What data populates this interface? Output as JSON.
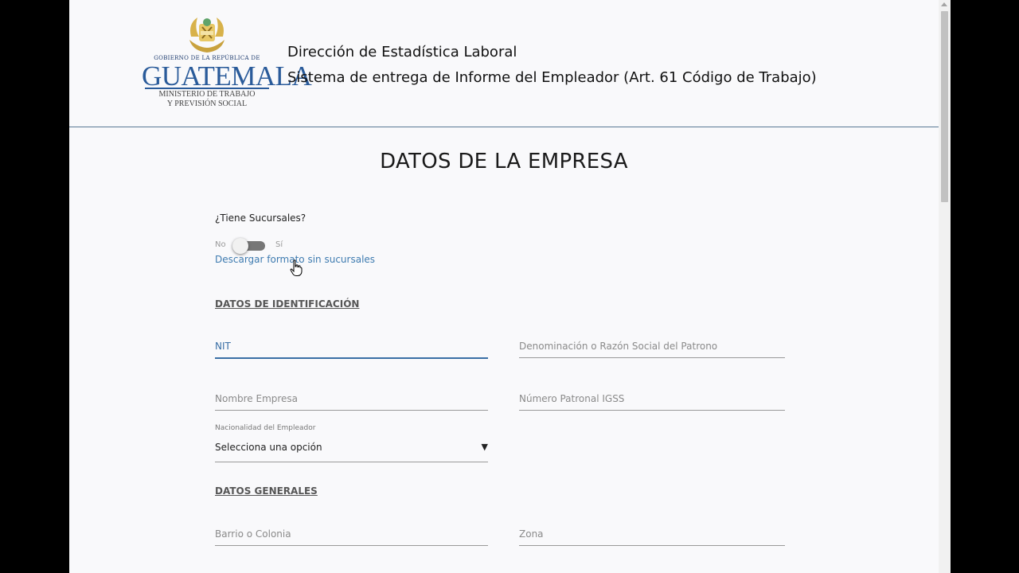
{
  "header": {
    "logo": {
      "line1": "GOBIERNO DE LA REPÚBLICA DE",
      "line2": "GUATEMALA",
      "line3": "MINISTERIO DE TRABAJO",
      "line4": "Y PREVISIÓN SOCIAL"
    },
    "title": "Dirección de Estadística Laboral",
    "subtitle": "Sistema de entrega de Informe del Empleador (Art. 61 Código de Trabajo)"
  },
  "page_title": "DATOS DE LA EMPRESA",
  "sucursales": {
    "question": "¿Tiene Sucursales?",
    "toggle_off_label": "No",
    "toggle_on_label": "Sí",
    "toggle_value": "No",
    "download_link": "Descargar formato sin sucursales"
  },
  "sections": {
    "identificacion": "DATOS DE IDENTIFICACIÓN",
    "generales": "DATOS GENERALES"
  },
  "fields": {
    "nit": {
      "placeholder": "NIT",
      "value": ""
    },
    "razon_social": {
      "placeholder": "Denominación o Razón Social del Patrono",
      "value": ""
    },
    "nombre_empresa": {
      "placeholder": "Nombre Empresa",
      "value": ""
    },
    "numero_patronal": {
      "placeholder": "Número Patronal IGSS",
      "value": ""
    },
    "nacionalidad": {
      "label": "Nacionalidad del Empleador",
      "selected": "Selecciona una opción"
    },
    "barrio": {
      "placeholder": "Barrio o Colonia",
      "value": ""
    },
    "zona": {
      "placeholder": "Zona",
      "value": ""
    }
  },
  "colors": {
    "accent": "#3a6fa5",
    "link": "#3e7bb0",
    "header_border": "#5a7a95",
    "page_bg": "#f9f9fb"
  },
  "icons": {
    "emblem": "guatemala-coat-of-arms",
    "cursor": "hand-pointer-icon",
    "select_arrow": "triangle-down-icon"
  }
}
